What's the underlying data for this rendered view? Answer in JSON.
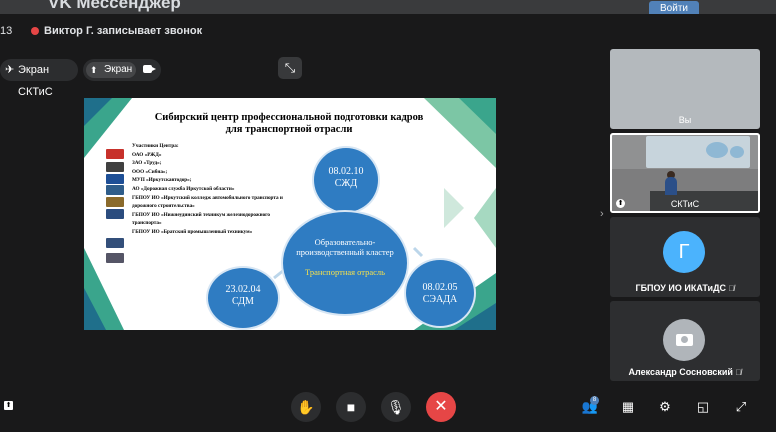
{
  "app": {
    "title": "VK Мессенджер",
    "login_label": "Войти"
  },
  "call": {
    "participant_count": "13",
    "recording_status": "Виктор Г. записывает звонок",
    "pinned_label": "Экран СКТиС",
    "screen_label": "Экран"
  },
  "slide": {
    "title": "Сибирский центр профессиональной подготовки кадров для транспортной отрасли",
    "members": [
      "Участники Центра:",
      "ОАО «РЖД»",
      "ЗАО «Труд»;",
      "ООО «Сибна»;",
      "МУП «Иркутскавтодор»;",
      "АО «Дорожная служба Иркутской области»",
      "ГБПОУ ИО «Иркутский колледж автомобильного транспорта и",
      "дорожного строительства»",
      "ГБПОУ ИО «Нижнеудинский техникум железнодорожного",
      "транспорта»",
      "ГБПОУ ИО «Братский промышленный техникум»"
    ],
    "circle_top": {
      "code": "08.02.10",
      "abbr": "СЖД"
    },
    "circle_center": {
      "text": "Образовательно-производственный кластер",
      "highlight": "Транспортная отрасль"
    },
    "circle_left": {
      "code": "23.02.04",
      "abbr": "СДМ"
    },
    "circle_right": {
      "code": "08.02.05",
      "abbr": "СЭАДА"
    }
  },
  "participants": [
    {
      "name": "Вы"
    },
    {
      "name": "СКТиС"
    },
    {
      "name": "ГБПОУ ИО ИКАТиДС",
      "initial": "Г"
    },
    {
      "name": "Александр Сосновский"
    }
  ],
  "toolbar": {
    "participants_badge": "8"
  },
  "colors": {
    "accent": "#5181b8",
    "end_call": "#e64646",
    "avatar_blue": "#4bb3fd",
    "slide_circle": "#2f7cc2",
    "slide_triangles": "#3aa58c"
  }
}
